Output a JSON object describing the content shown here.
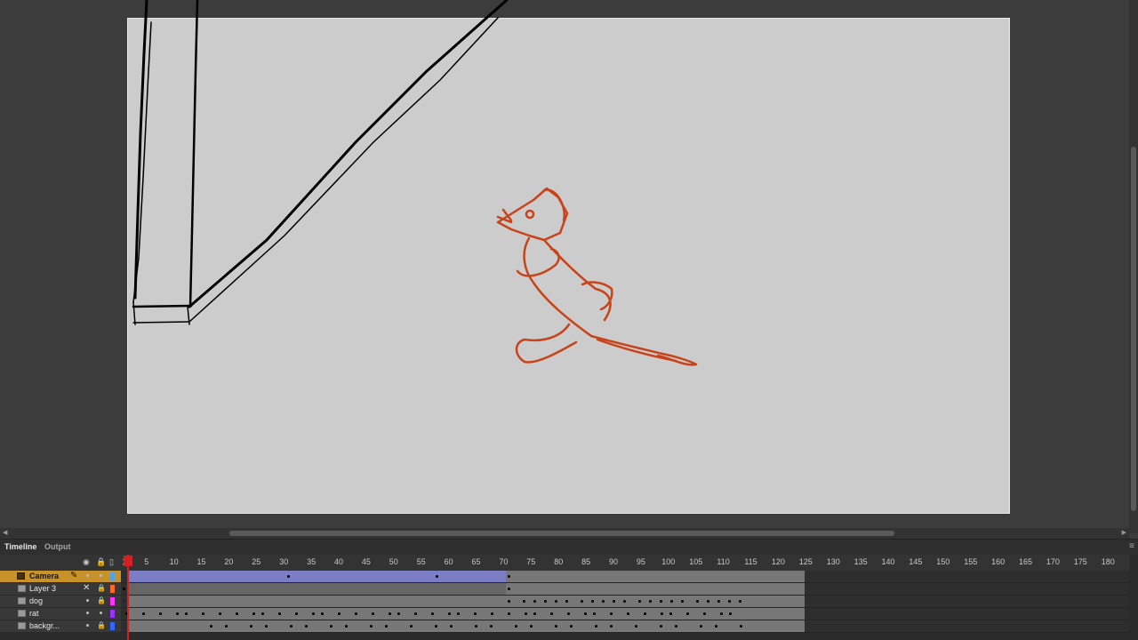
{
  "timeline_tabs": [
    {
      "label": "Timeline",
      "active": true
    },
    {
      "label": "Output",
      "active": false
    }
  ],
  "ruler": {
    "current_frame": "1",
    "ticks": [
      "5",
      "10",
      "15",
      "20",
      "25",
      "30",
      "35",
      "40",
      "45",
      "50",
      "55",
      "60",
      "65",
      "70",
      "75",
      "80",
      "85",
      "90",
      "95",
      "100",
      "105",
      "110",
      "115",
      "120",
      "125",
      "130",
      "135",
      "140",
      "145",
      "150",
      "155",
      "160",
      "165",
      "170",
      "175",
      "180"
    ]
  },
  "layers": [
    {
      "name": "Camera",
      "icon": "camera-icon",
      "selected": true,
      "color": "#4fa3e8"
    },
    {
      "name": "Layer 3",
      "icon": "layer-icon",
      "selected": false,
      "color": "#ff6a2a"
    },
    {
      "name": "dog",
      "icon": "layer-icon",
      "selected": false,
      "color": "#ff33ff"
    },
    {
      "name": "rat",
      "icon": "layer-icon",
      "selected": false,
      "color": "#9a33ff"
    },
    {
      "name": "backgr...",
      "icon": "layer-icon",
      "selected": false,
      "color": "#3366ff"
    }
  ],
  "header_icons": [
    "eye-icon",
    "lock-icon",
    "outline-icon"
  ],
  "colors": {
    "stage": "#cccccc",
    "drawing_line": "#000000",
    "rat_stroke": "#c8431a",
    "playhead": "#d42020",
    "selected_layer": "#c8922a",
    "tween": "#7b7ec4"
  }
}
